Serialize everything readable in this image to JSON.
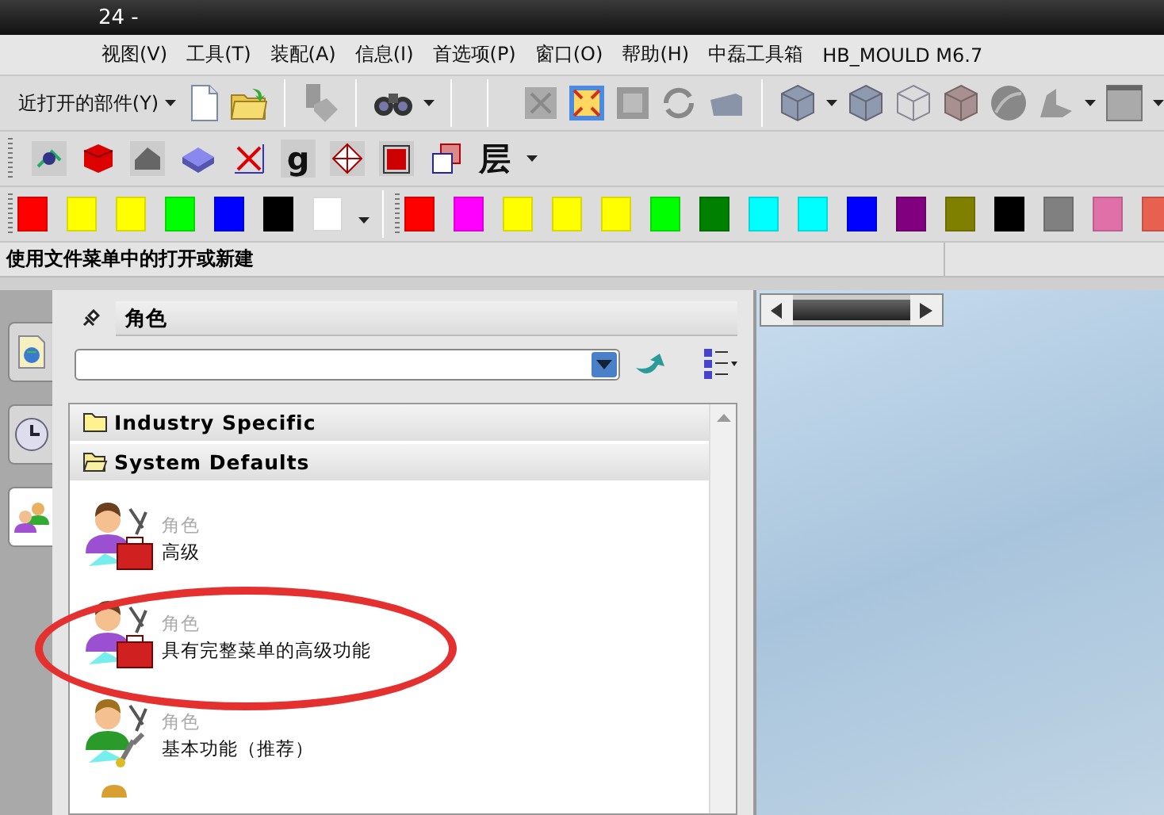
{
  "window": {
    "title": "24 -"
  },
  "menu": [
    "视图(V)",
    "工具(T)",
    "装配(A)",
    "信息(I)",
    "首选项(P)",
    "窗口(O)",
    "帮助(H)",
    "中磊工具箱",
    "HB_MOULD M6.7"
  ],
  "toolbar_1": {
    "recent_parts": "近打开的部件(Y)"
  },
  "toolbar_2": {
    "glyphs": [
      "g",
      "层"
    ]
  },
  "color_bar_1": [
    {
      "color": "#ff0000"
    },
    {
      "color": "#ffff00"
    },
    {
      "color": "#ffff00"
    },
    {
      "color": "#00ff00"
    },
    {
      "color": "#0000ff"
    },
    {
      "color": "#000000"
    },
    {
      "color": "#ffffff"
    }
  ],
  "color_bar_2": [
    {
      "color": "#ff0000"
    },
    {
      "color": "#ff00ff"
    },
    {
      "color": "#ffff00"
    },
    {
      "color": "#ffff00"
    },
    {
      "color": "#ffff00"
    },
    {
      "color": "#00ff00"
    },
    {
      "color": "#008000"
    },
    {
      "color": "#00ffff"
    },
    {
      "color": "#00ffff"
    },
    {
      "color": "#0000ff"
    },
    {
      "color": "#800080"
    },
    {
      "color": "#808000"
    },
    {
      "color": "#000000"
    },
    {
      "color": "#808080"
    },
    {
      "color": "#e070a8"
    },
    {
      "color": "#e86050"
    }
  ],
  "status_bar": {
    "message": "使用文件菜单中的打开或新建"
  },
  "side_tabs": [
    {
      "selected": false
    },
    {
      "selected": false
    },
    {
      "selected": true
    }
  ],
  "roles_panel": {
    "title": "角色",
    "categories": [
      {
        "label": "Industry Specific",
        "expanded": false
      },
      {
        "label": "System Defaults",
        "expanded": true
      }
    ],
    "roles": [
      {
        "type": "角色",
        "name": "高级"
      },
      {
        "type": "角色",
        "name": "具有完整菜单的高级功能"
      },
      {
        "type": "角色",
        "name": "基本功能（推荐）"
      }
    ]
  }
}
